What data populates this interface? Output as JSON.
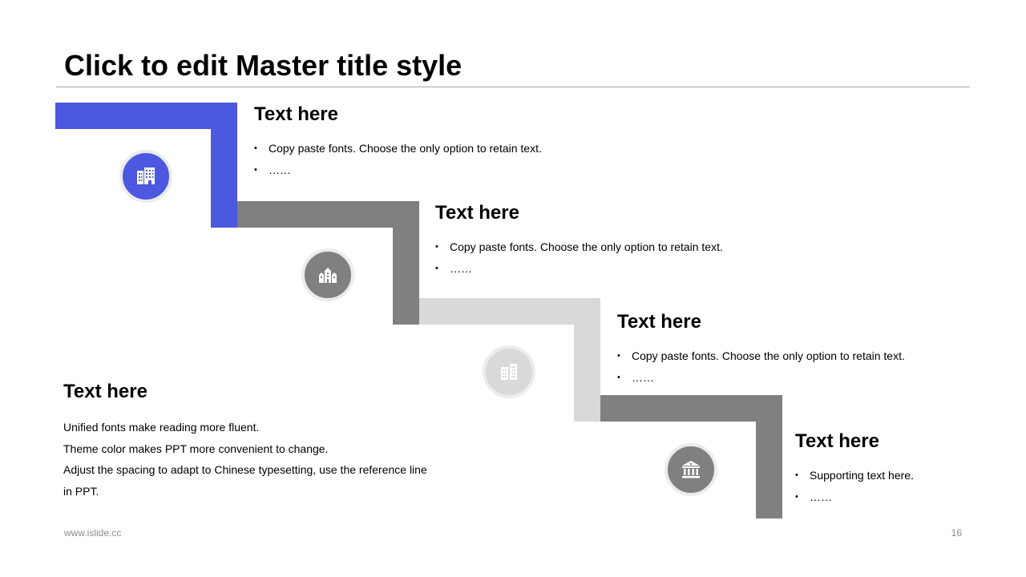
{
  "slide": {
    "title": "Click to edit Master title style",
    "footer_url": "www.islide.cc",
    "page_number": "16"
  },
  "colors": {
    "accent": "#4b58df",
    "dark_gray": "#808080",
    "light_gray": "#d9d9d9"
  },
  "steps": [
    {
      "heading": "Text here",
      "bullets": [
        "Copy paste fonts. Choose the only option to retain text.",
        "……"
      ],
      "icon": "office-building-icon"
    },
    {
      "heading": "Text here",
      "bullets": [
        "Copy paste fonts. Choose the only option to retain text.",
        "……"
      ],
      "icon": "city-buildings-icon"
    },
    {
      "heading": "Text here",
      "bullets": [
        "Copy paste fonts. Choose the only option to retain text.",
        "……"
      ],
      "icon": "apartment-buildings-icon"
    },
    {
      "heading": "Text here",
      "bullets": [
        "Supporting text here.",
        "……"
      ],
      "icon": "bank-icon"
    }
  ],
  "summary": {
    "heading": "Text here",
    "lines": [
      "Unified fonts make reading more fluent.",
      "Theme color makes PPT more convenient to change.",
      "Adjust the spacing to adapt to Chinese typesetting, use the reference line",
      "in PPT."
    ]
  }
}
